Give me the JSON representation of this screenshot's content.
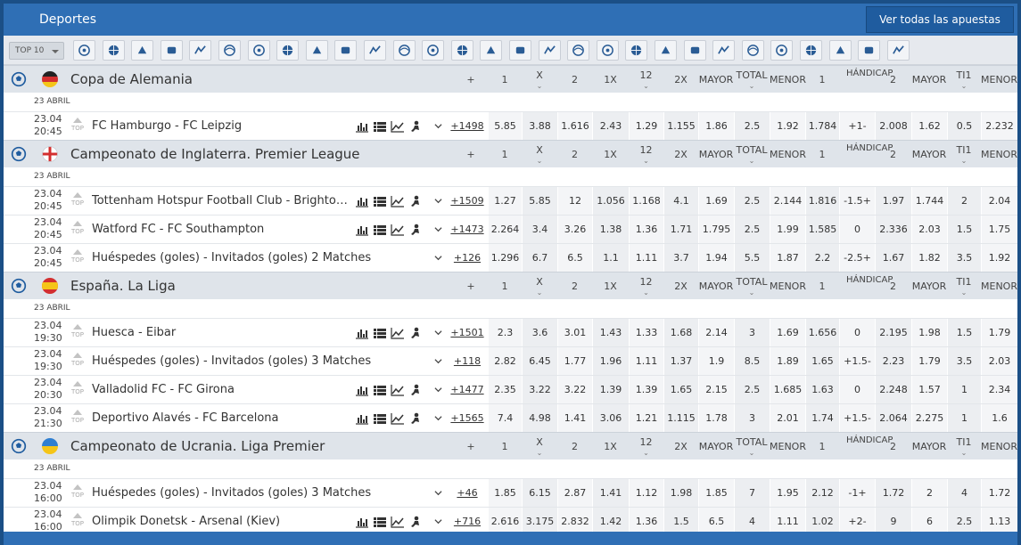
{
  "header": {
    "title": "Deportes",
    "all_bets_label": "Ver todas las apuestas"
  },
  "sports_bar": {
    "top10_label": "TOP 10",
    "icons": [
      "soccer-icon",
      "basketball-icon",
      "volleyball-icon",
      "hockey-icon",
      "handball-icon",
      "table-tennis-icon",
      "esports-gamepad-icon",
      "star-icon",
      "badminton-icon",
      "futsal-icon",
      "rugby-icon",
      "cricket-icon",
      "tennis-icon",
      "horse-racing-icon",
      "greyhound-icon",
      "cycling-icon",
      "hockey-stick-icon",
      "darts-icon",
      "motorsport-icon",
      "football-icon",
      "dog-racing-icon",
      "golf-icon",
      "tv-icon",
      "list-icon",
      "chess-icon",
      "american-football-icon",
      "snooker-icon",
      "horse-icon",
      "trotting-icon"
    ]
  },
  "odds_headers": [
    "+",
    "1",
    "X",
    "2",
    "1X",
    "12",
    "2X",
    "MAYOR",
    "TOTAL",
    "MENOR",
    "1",
    "HÁNDICAP",
    "2",
    "MAYOR",
    "TI1",
    "MENOR"
  ],
  "leagues": [
    {
      "name": "Copa de Alemania",
      "flag": "germany",
      "date_label": "23 ABRIL",
      "matches": [
        {
          "date": "23.04",
          "time": "20:45",
          "top": "TOP",
          "name": "FC Hamburgo - FC Leipzig",
          "more": "+1498",
          "stats": true,
          "odds": [
            "5.85",
            "3.88",
            "1.616",
            "2.43",
            "1.29",
            "1.155",
            "1.86",
            "2.5",
            "1.92",
            "1.784",
            "+1-",
            "2.008",
            "1.62",
            "0.5",
            "2.232"
          ]
        }
      ]
    },
    {
      "name": "Campeonato de Inglaterra. Premier League",
      "flag": "england",
      "date_label": "23 ABRIL",
      "matches": [
        {
          "date": "23.04",
          "time": "20:45",
          "top": "TOP",
          "name": "Tottenham Hotspur Football Club - Brighton & Hove Albion",
          "more": "+1509",
          "stats": true,
          "odds": [
            "1.27",
            "5.85",
            "12",
            "1.056",
            "1.168",
            "4.1",
            "1.69",
            "2.5",
            "2.144",
            "1.816",
            "-1.5+",
            "1.97",
            "1.744",
            "2",
            "2.04"
          ]
        },
        {
          "date": "23.04",
          "time": "20:45",
          "top": "TOP",
          "name": "Watford FC - FC Southampton",
          "more": "+1473",
          "stats": true,
          "odds": [
            "2.264",
            "3.4",
            "3.26",
            "1.38",
            "1.36",
            "1.71",
            "1.795",
            "2.5",
            "1.99",
            "1.585",
            "0",
            "2.336",
            "2.03",
            "1.5",
            "1.75"
          ]
        },
        {
          "date": "23.04",
          "time": "20:45",
          "top": "TOP",
          "name": "Huéspedes (goles) - Invitados (goles) 2 Matches",
          "more": "+126",
          "stats": false,
          "odds": [
            "1.296",
            "6.7",
            "6.5",
            "1.1",
            "1.11",
            "3.7",
            "1.94",
            "5.5",
            "1.87",
            "2.2",
            "-2.5+",
            "1.67",
            "1.82",
            "3.5",
            "1.92"
          ]
        }
      ]
    },
    {
      "name": "España. La Liga",
      "flag": "spain",
      "date_label": "23 ABRIL",
      "matches": [
        {
          "date": "23.04",
          "time": "19:30",
          "top": "TOP",
          "name": "Huesca - Eibar",
          "more": "+1501",
          "stats": true,
          "odds": [
            "2.3",
            "3.6",
            "3.01",
            "1.43",
            "1.33",
            "1.68",
            "2.14",
            "3",
            "1.69",
            "1.656",
            "0",
            "2.195",
            "1.98",
            "1.5",
            "1.79"
          ]
        },
        {
          "date": "23.04",
          "time": "19:30",
          "top": "TOP",
          "name": "Huéspedes (goles) - Invitados (goles) 3 Matches",
          "more": "+118",
          "stats": false,
          "odds": [
            "2.82",
            "6.45",
            "1.77",
            "1.96",
            "1.11",
            "1.37",
            "1.9",
            "8.5",
            "1.89",
            "1.65",
            "+1.5-",
            "2.23",
            "1.79",
            "3.5",
            "2.03"
          ]
        },
        {
          "date": "23.04",
          "time": "20:30",
          "top": "TOP",
          "name": "Valladolid FC - FC Girona",
          "more": "+1477",
          "stats": true,
          "odds": [
            "2.35",
            "3.22",
            "3.22",
            "1.39",
            "1.39",
            "1.65",
            "2.15",
            "2.5",
            "1.685",
            "1.63",
            "0",
            "2.248",
            "1.57",
            "1",
            "2.34"
          ]
        },
        {
          "date": "23.04",
          "time": "21:30",
          "top": "TOP",
          "name": "Deportivo Alavés - FC Barcelona",
          "more": "+1565",
          "stats": true,
          "odds": [
            "7.4",
            "4.98",
            "1.41",
            "3.06",
            "1.21",
            "1.115",
            "1.78",
            "3",
            "2.01",
            "1.74",
            "+1.5-",
            "2.064",
            "2.275",
            "1",
            "1.6"
          ]
        }
      ]
    },
    {
      "name": "Campeonato de Ucrania. Liga Premier",
      "flag": "ukraine",
      "date_label": "23 ABRIL",
      "matches": [
        {
          "date": "23.04",
          "time": "16:00",
          "top": "TOP",
          "name": "Huéspedes (goles) - Invitados (goles) 3 Matches",
          "more": "+46",
          "stats": false,
          "odds": [
            "1.85",
            "6.15",
            "2.87",
            "1.41",
            "1.12",
            "1.98",
            "1.85",
            "7",
            "1.95",
            "2.12",
            "-1+",
            "1.72",
            "2",
            "4",
            "1.72"
          ]
        },
        {
          "date": "23.04",
          "time": "16:00",
          "top": "TOP",
          "name": "Olimpik Donetsk - Arsenal (Kiev)",
          "more": "+716",
          "stats": true,
          "odds": [
            "2.616",
            "3.175",
            "2.832",
            "1.42",
            "1.36",
            "1.5",
            "6.5",
            "4",
            "1.11",
            "1.02",
            "+2-",
            "9",
            "6",
            "2.5",
            "1.13"
          ]
        }
      ]
    }
  ],
  "colors": {
    "brand": "#2f6fb5",
    "frame": "#1b4f86",
    "league_bg": "#dfe4ea"
  }
}
